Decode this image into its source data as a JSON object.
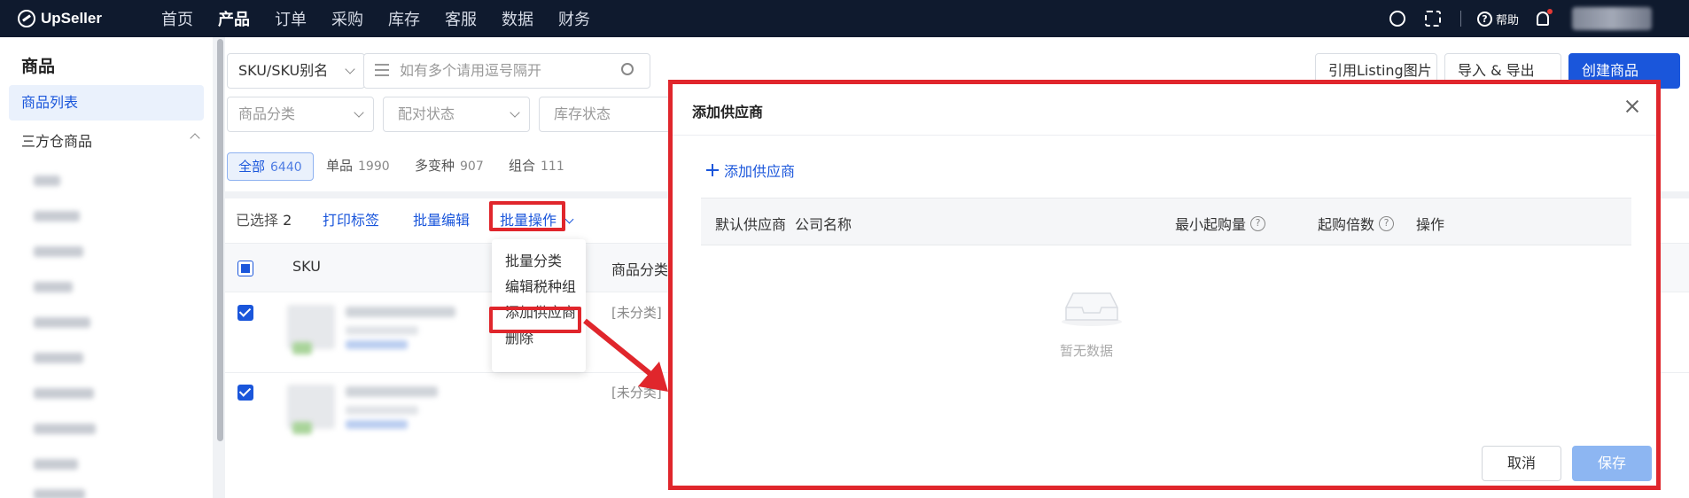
{
  "nav": {
    "logo": "UpSeller",
    "items": [
      "首页",
      "产品",
      "订单",
      "采购",
      "库存",
      "客服",
      "数据",
      "财务"
    ],
    "active_index": 1,
    "help": "帮助"
  },
  "sidebar": {
    "title": "商品",
    "active_item": "商品列表",
    "group": "三方仓商品"
  },
  "filters": {
    "sku_type": "SKU/SKU别名",
    "search_placeholder": "如有多个请用逗号隔开",
    "category_placeholder": "商品分类",
    "pair_status_placeholder": "配对状态",
    "stock_status_placeholder": "库存状态"
  },
  "toolbar_right": {
    "cite_listing": "引用Listing图片",
    "import_export": "导入 & 导出",
    "create": "创建商品"
  },
  "tabs": [
    {
      "label": "全部",
      "count": "6440"
    },
    {
      "label": "单品",
      "count": "1990"
    },
    {
      "label": "多变种",
      "count": "907"
    },
    {
      "label": "组合",
      "count": "111"
    }
  ],
  "actions": {
    "selected_label": "已选择",
    "selected_count": "2",
    "print_label": "打印标签",
    "batch_edit": "批量编辑",
    "batch_ops": "批量操作"
  },
  "table": {
    "col_sku": "SKU",
    "col_category": "商品分类",
    "rows": [
      {
        "category": "[未分类]",
        "checked": true
      },
      {
        "category": "[未分类]",
        "checked": true
      }
    ]
  },
  "menu": {
    "items": [
      "批量分类",
      "编辑税种组",
      "添加供应商",
      "删除"
    ],
    "highlighted_index": 2
  },
  "modal": {
    "title": "添加供应商",
    "add_label": "添加供应商",
    "columns": {
      "default_supplier": "默认供应商",
      "company": "公司名称",
      "min_qty": "最小起购量",
      "multiple": "起购倍数",
      "ops": "操作"
    },
    "empty_text": "暂无数据",
    "cancel": "取消",
    "save": "保存"
  },
  "colors": {
    "accent": "#1a56db",
    "highlight": "#e0262c",
    "nav_bg": "#0f1a2e"
  }
}
